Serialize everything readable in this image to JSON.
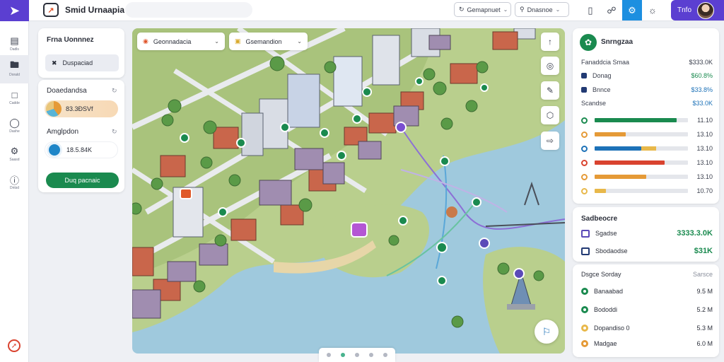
{
  "app": {
    "title": "Smid Urnaapia"
  },
  "rail": {
    "items": [
      {
        "label": "Dadls",
        "icon": "layout-icon"
      },
      {
        "label": "Dorald",
        "icon": "folder-icon"
      },
      {
        "label": "Cadde",
        "icon": "file-icon"
      },
      {
        "label": "Dashe",
        "icon": "compass-icon"
      },
      {
        "label": "Saasd",
        "icon": "gear-icon"
      },
      {
        "label": "Dntsd",
        "icon": "help-icon"
      }
    ]
  },
  "topbar": {
    "drop1": "Gemapnuet",
    "drop2": "Dnasnoe"
  },
  "user": {
    "name": "Tnfo"
  },
  "left_panel": {
    "card_title": "Frna Uonnnez",
    "destination": "Duspaciad",
    "section1_title": "Doaedandsa",
    "section1_value": "83.3ĐSVf",
    "section2_title": "Amglpdon",
    "section2_value": "18.5.84K",
    "go_button": "Duq pacnaic"
  },
  "map": {
    "dropdown1": "Geonnadacia",
    "dropdown2": "Gsemandion"
  },
  "right_panel": {
    "title": "Snrngzaa",
    "top_rows": [
      {
        "label": "Fanaddcia Smaa",
        "value": "$333.0K",
        "color": ""
      },
      {
        "label": "Donag",
        "value": "$60.8%",
        "color": "green"
      },
      {
        "label": "Bnnce",
        "value": "$33.8%",
        "color": "blue"
      },
      {
        "label": "Scandse",
        "value": "$33.0K",
        "color": "blue"
      }
    ],
    "bars": [
      {
        "value": "11.10",
        "color": "#1a8a4f",
        "fill": 0.88,
        "accent": null,
        "accent_fill": 0
      },
      {
        "value": "13.10",
        "color": "#e59a37",
        "fill": 0.33,
        "accent": null,
        "accent_fill": 0
      },
      {
        "value": "13.10",
        "color": "#1d72b8",
        "fill": 0.5,
        "accent": "#e8b84a",
        "accent_fill": 0.16
      },
      {
        "value": "13.10",
        "color": "#d9432f",
        "fill": 0.75,
        "accent": null,
        "accent_fill": 0
      },
      {
        "value": "13.10",
        "color": "#e59a37",
        "fill": 0.55,
        "accent": null,
        "accent_fill": 0
      },
      {
        "value": "10.70",
        "color": "#e8b84a",
        "fill": 0.12,
        "accent": null,
        "accent_fill": 0
      }
    ],
    "card2_title": "Sadbeocre",
    "card2_rows": [
      {
        "label": "Sgadse",
        "value": "3333.3.0K"
      },
      {
        "label": "Sbodaodse",
        "value": "$31K"
      }
    ],
    "card3_head_label": "Dsgce Sorday",
    "card3_head_value": "Sarsce",
    "card3_rows": [
      {
        "label": "Banaabad",
        "value": "9.5 M",
        "color": "#1a8a4f"
      },
      {
        "label": "Bododdi",
        "value": "5.2 M",
        "color": "#1a8a4f"
      },
      {
        "label": "Dopandiso 0",
        "value": "5.3 M",
        "color": "#e8b84a"
      },
      {
        "label": "Madgae",
        "value": "6.0 M",
        "color": "#e59a37"
      }
    ]
  }
}
